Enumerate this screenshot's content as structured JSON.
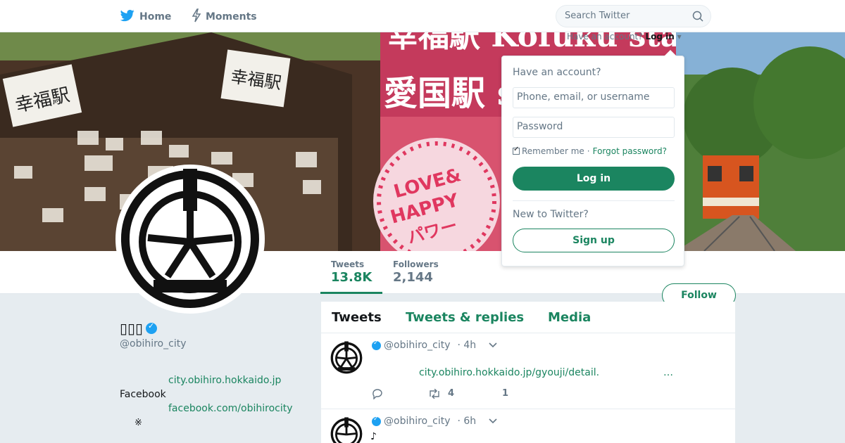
{
  "nav": {
    "home_label": "Home",
    "moments_label": "Moments",
    "search_placeholder": "Search Twitter"
  },
  "banner": {
    "left_sign": "幸福駅",
    "center_sign": "幸福駅",
    "top_text": "幸福駅 Kofuku station",
    "second_text": "愛国駅 station",
    "heart_text_1": "LOVE&",
    "heart_text_2": "HAPPY",
    "heart_text_3": "パワー"
  },
  "login_hint": {
    "prefix": "Have an account?",
    "link": "Log in"
  },
  "login_dropdown": {
    "title": "Have an account?",
    "username_placeholder": "Phone, email, or username",
    "password_placeholder": "Password",
    "remember_label": "Remember me",
    "separator": "·",
    "forgot_label": "Forgot password?",
    "login_button": "Log in",
    "new_label": "New to Twitter?",
    "signup_button": "Sign up"
  },
  "profile": {
    "name": "▯▯▯",
    "screen_name": "@obihiro_city",
    "bio_link_1": "city.obihiro.hokkaido.jp",
    "facebook_label": "Facebook",
    "bio_link_2": "facebook.com/obihirocity",
    "bio_mark": "※"
  },
  "stats": {
    "tweets_label": "Tweets",
    "tweets_value": "13.8K",
    "followers_label": "Followers",
    "followers_value": "2,144"
  },
  "follow_button": "Follow",
  "tabs": {
    "tweets": "Tweets",
    "replies": "Tweets & replies",
    "media": "Media"
  },
  "tweets": [
    {
      "handle": "@obihiro_city",
      "time": "· 4h",
      "link": "city.obihiro.hokkaido.jp/gyouji/detail.",
      "ellipsis": "…",
      "retweets": "4",
      "likes": "1"
    },
    {
      "handle": "@obihiro_city",
      "time": "· 6h",
      "text": "♪"
    }
  ],
  "colors": {
    "accent": "#1b8560",
    "verified": "#1da1f2",
    "muted": "#657786"
  }
}
